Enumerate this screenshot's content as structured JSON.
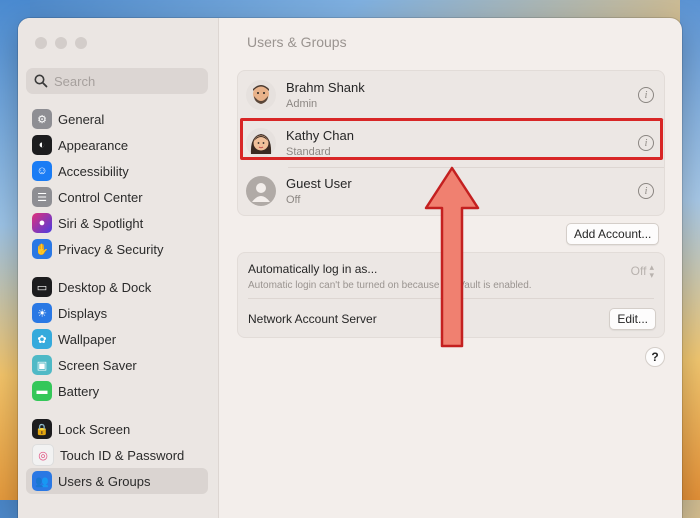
{
  "window": {
    "title": "Users & Groups"
  },
  "search": {
    "placeholder": "Search",
    "icon": "magnifying-glass-icon"
  },
  "sidebar": {
    "items": [
      {
        "label": "General",
        "icon": "gear-icon",
        "color": "#8e8e93"
      },
      {
        "label": "Appearance",
        "icon": "appearance-icon",
        "color": "#1c1c1e"
      },
      {
        "label": "Accessibility",
        "icon": "accessibility-icon",
        "color": "#1a7cf5"
      },
      {
        "label": "Control Center",
        "icon": "control-center-icon",
        "color": "#8e8e93"
      },
      {
        "label": "Siri & Spotlight",
        "icon": "siri-icon",
        "color": "#6f3bd8"
      },
      {
        "label": "Privacy & Security",
        "icon": "hand-icon",
        "color": "#2a78e4"
      },
      {
        "label": "Desktop & Dock",
        "icon": "dock-icon",
        "color": "#1c1c1e"
      },
      {
        "label": "Displays",
        "icon": "display-icon",
        "color": "#2a78e4"
      },
      {
        "label": "Wallpaper",
        "icon": "wallpaper-icon",
        "color": "#35aadc"
      },
      {
        "label": "Screen Saver",
        "icon": "screen-saver-icon",
        "color": "#4fb9c6"
      },
      {
        "label": "Battery",
        "icon": "battery-icon",
        "color": "#34c759"
      },
      {
        "label": "Lock Screen",
        "icon": "lock-icon",
        "color": "#1c1c1e"
      },
      {
        "label": "Touch ID & Password",
        "icon": "fingerprint-icon",
        "color": "#f2f2f2"
      },
      {
        "label": "Users & Groups",
        "icon": "users-icon",
        "color": "#2a78e4"
      }
    ],
    "selected": "Users & Groups"
  },
  "users": [
    {
      "name": "Brahm Shank",
      "role": "Admin"
    },
    {
      "name": "Kathy Chan",
      "role": "Standard"
    },
    {
      "name": "Guest User",
      "role": "Off"
    }
  ],
  "add_account_label": "Add Account...",
  "auto_login": {
    "label": "Automatically log in as...",
    "description": "Automatic login can't be turned on because FileVault is enabled.",
    "value": "Off"
  },
  "network": {
    "label": "Network Account Server",
    "button": "Edit..."
  },
  "help_label": "?",
  "colors": {
    "highlight": "#d82626",
    "arrow": "#f08070"
  }
}
